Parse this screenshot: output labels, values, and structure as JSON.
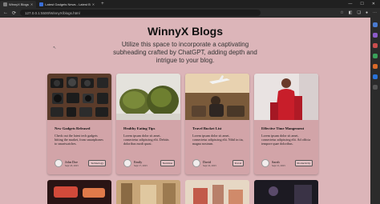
{
  "browser": {
    "tabs": [
      {
        "label": "WinnyX Blogs",
        "active": true
      },
      {
        "label": "Latest Gadgets News - Latest B",
        "active": false
      }
    ],
    "url": "127.0.0.1:5500/WinnyX/blogs.html"
  },
  "page": {
    "title": "WinnyX Blogs",
    "subtitle": "Utilize this space to incorporate a captivating subheading crafted by ChatGPT, adding depth and intrigue to your blog."
  },
  "cards": [
    {
      "title": "New Gadgets Released",
      "excerpt": "Check out the latest tech gadgets hitting the market, from smartphones to smartwatches.",
      "author": "John Doe",
      "date": "Sept 18, 2023",
      "tag": "Technology"
    },
    {
      "title": "Healthy Eating Tips",
      "excerpt": "Lorem ipsum dolor sit amet, consectetur adipiscing elit. Debitis doloribus modi quasi.",
      "author": "Emily",
      "date": "Sept 17, 2023",
      "tag": "Nutrition"
    },
    {
      "title": "Travel Bucket List",
      "excerpt": "Lorem ipsum dolor sit amet, consectetur adipiscing elit. Nihil in ita, magna nostrum.",
      "author": "David",
      "date": "Sept 16, 2023",
      "tag": "Travel"
    },
    {
      "title": "Effective Time Mangement",
      "excerpt": "Lorem ipsum dolor sit amet, consectetur adipiscing elit. Ad officia tempore quae doloribus.",
      "author": "Sarah",
      "date": "Sept 15, 2023",
      "tag": "Productivity"
    }
  ],
  "colors": {
    "page_background": "#dcb5b9",
    "card_background": "#d2a4a8",
    "browser_chrome": "#2b2b2b"
  }
}
